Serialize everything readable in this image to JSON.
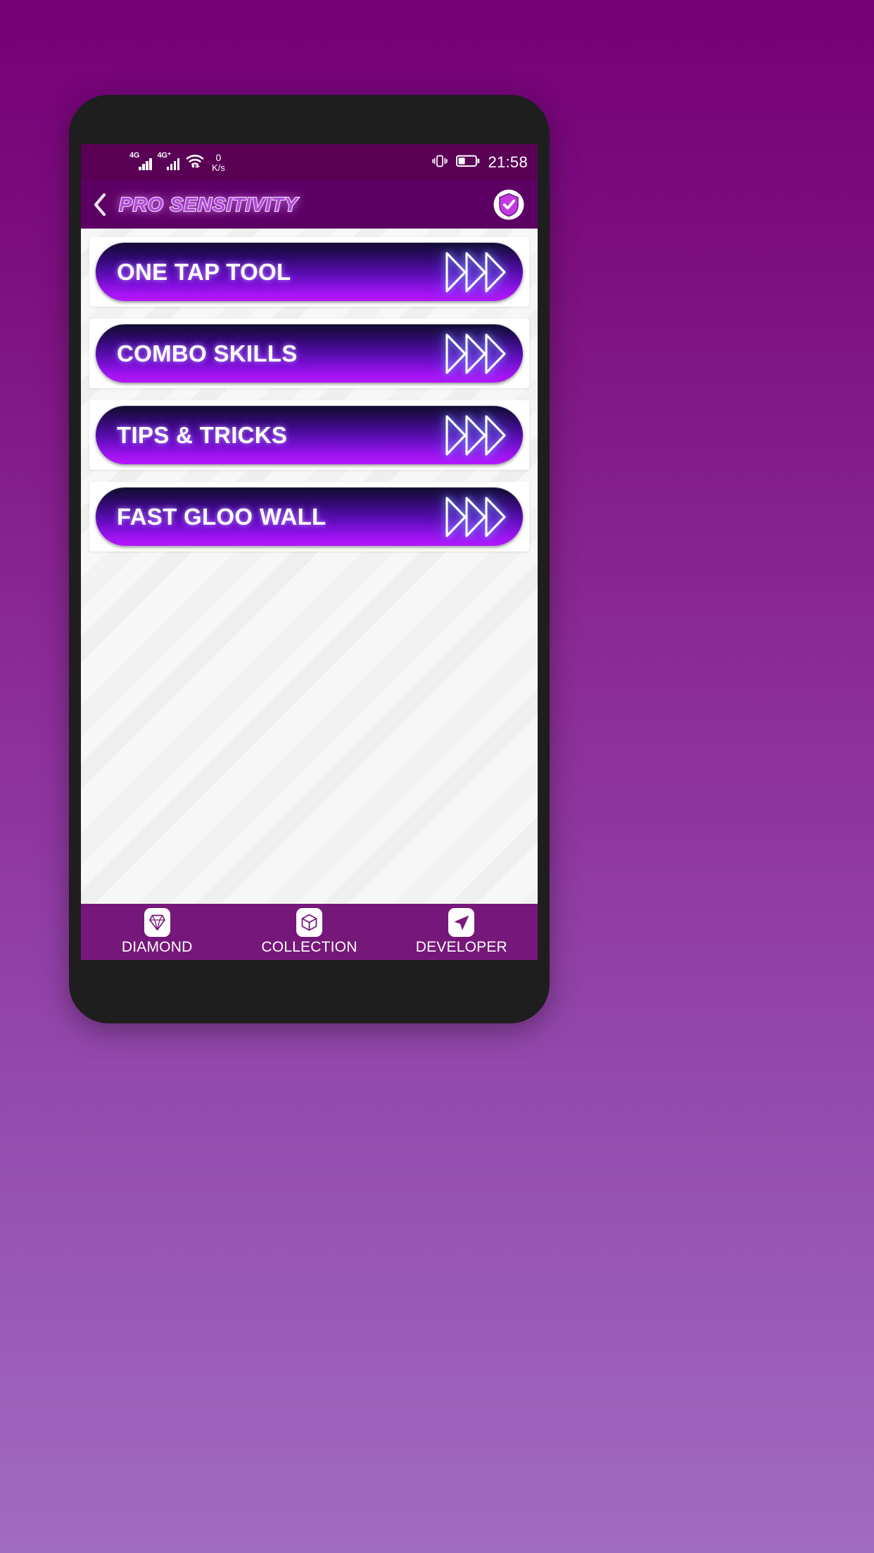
{
  "theme": {
    "page_bg_top": "#750077",
    "page_bg_bottom": "#a06cc0",
    "phone_frame": "#1e1e1e",
    "status_bar_bg": "#5a0055",
    "app_bar_bg": "#5d0064",
    "bottom_nav_bg": "#76187a",
    "button_gradient_top": "#120b30",
    "button_gradient_bottom": "#b515ff",
    "accent": "#b04bd6"
  },
  "status_bar": {
    "signal_1_label": "4G",
    "signal_2_label": "4G⁺",
    "wifi_icon": "wifi-icon",
    "network_speed_value": "0",
    "network_speed_unit": "K/s",
    "vibrate_icon": "vibrate-icon",
    "battery_icon": "battery-icon",
    "battery_level_pct": 35,
    "time": "21:58"
  },
  "app_bar": {
    "back_icon": "chevron-left-icon",
    "title": "PRO SENSITIVITY",
    "shield_icon": "shield-check-icon"
  },
  "menu": {
    "items": [
      {
        "label": "ONE TAP TOOL",
        "arrow_icon": "triple-chevron-right-icon"
      },
      {
        "label": "COMBO SKILLS",
        "arrow_icon": "triple-chevron-right-icon"
      },
      {
        "label": "TIPS & TRICKS",
        "arrow_icon": "triple-chevron-right-icon"
      },
      {
        "label": "FAST GLOO WALL",
        "arrow_icon": "triple-chevron-right-icon"
      }
    ]
  },
  "bottom_nav": {
    "items": [
      {
        "label": "DIAMOND",
        "icon": "diamond-icon"
      },
      {
        "label": "COLLECTION",
        "icon": "cube-icon"
      },
      {
        "label": "DEVELOPER",
        "icon": "paper-plane-icon"
      }
    ]
  }
}
